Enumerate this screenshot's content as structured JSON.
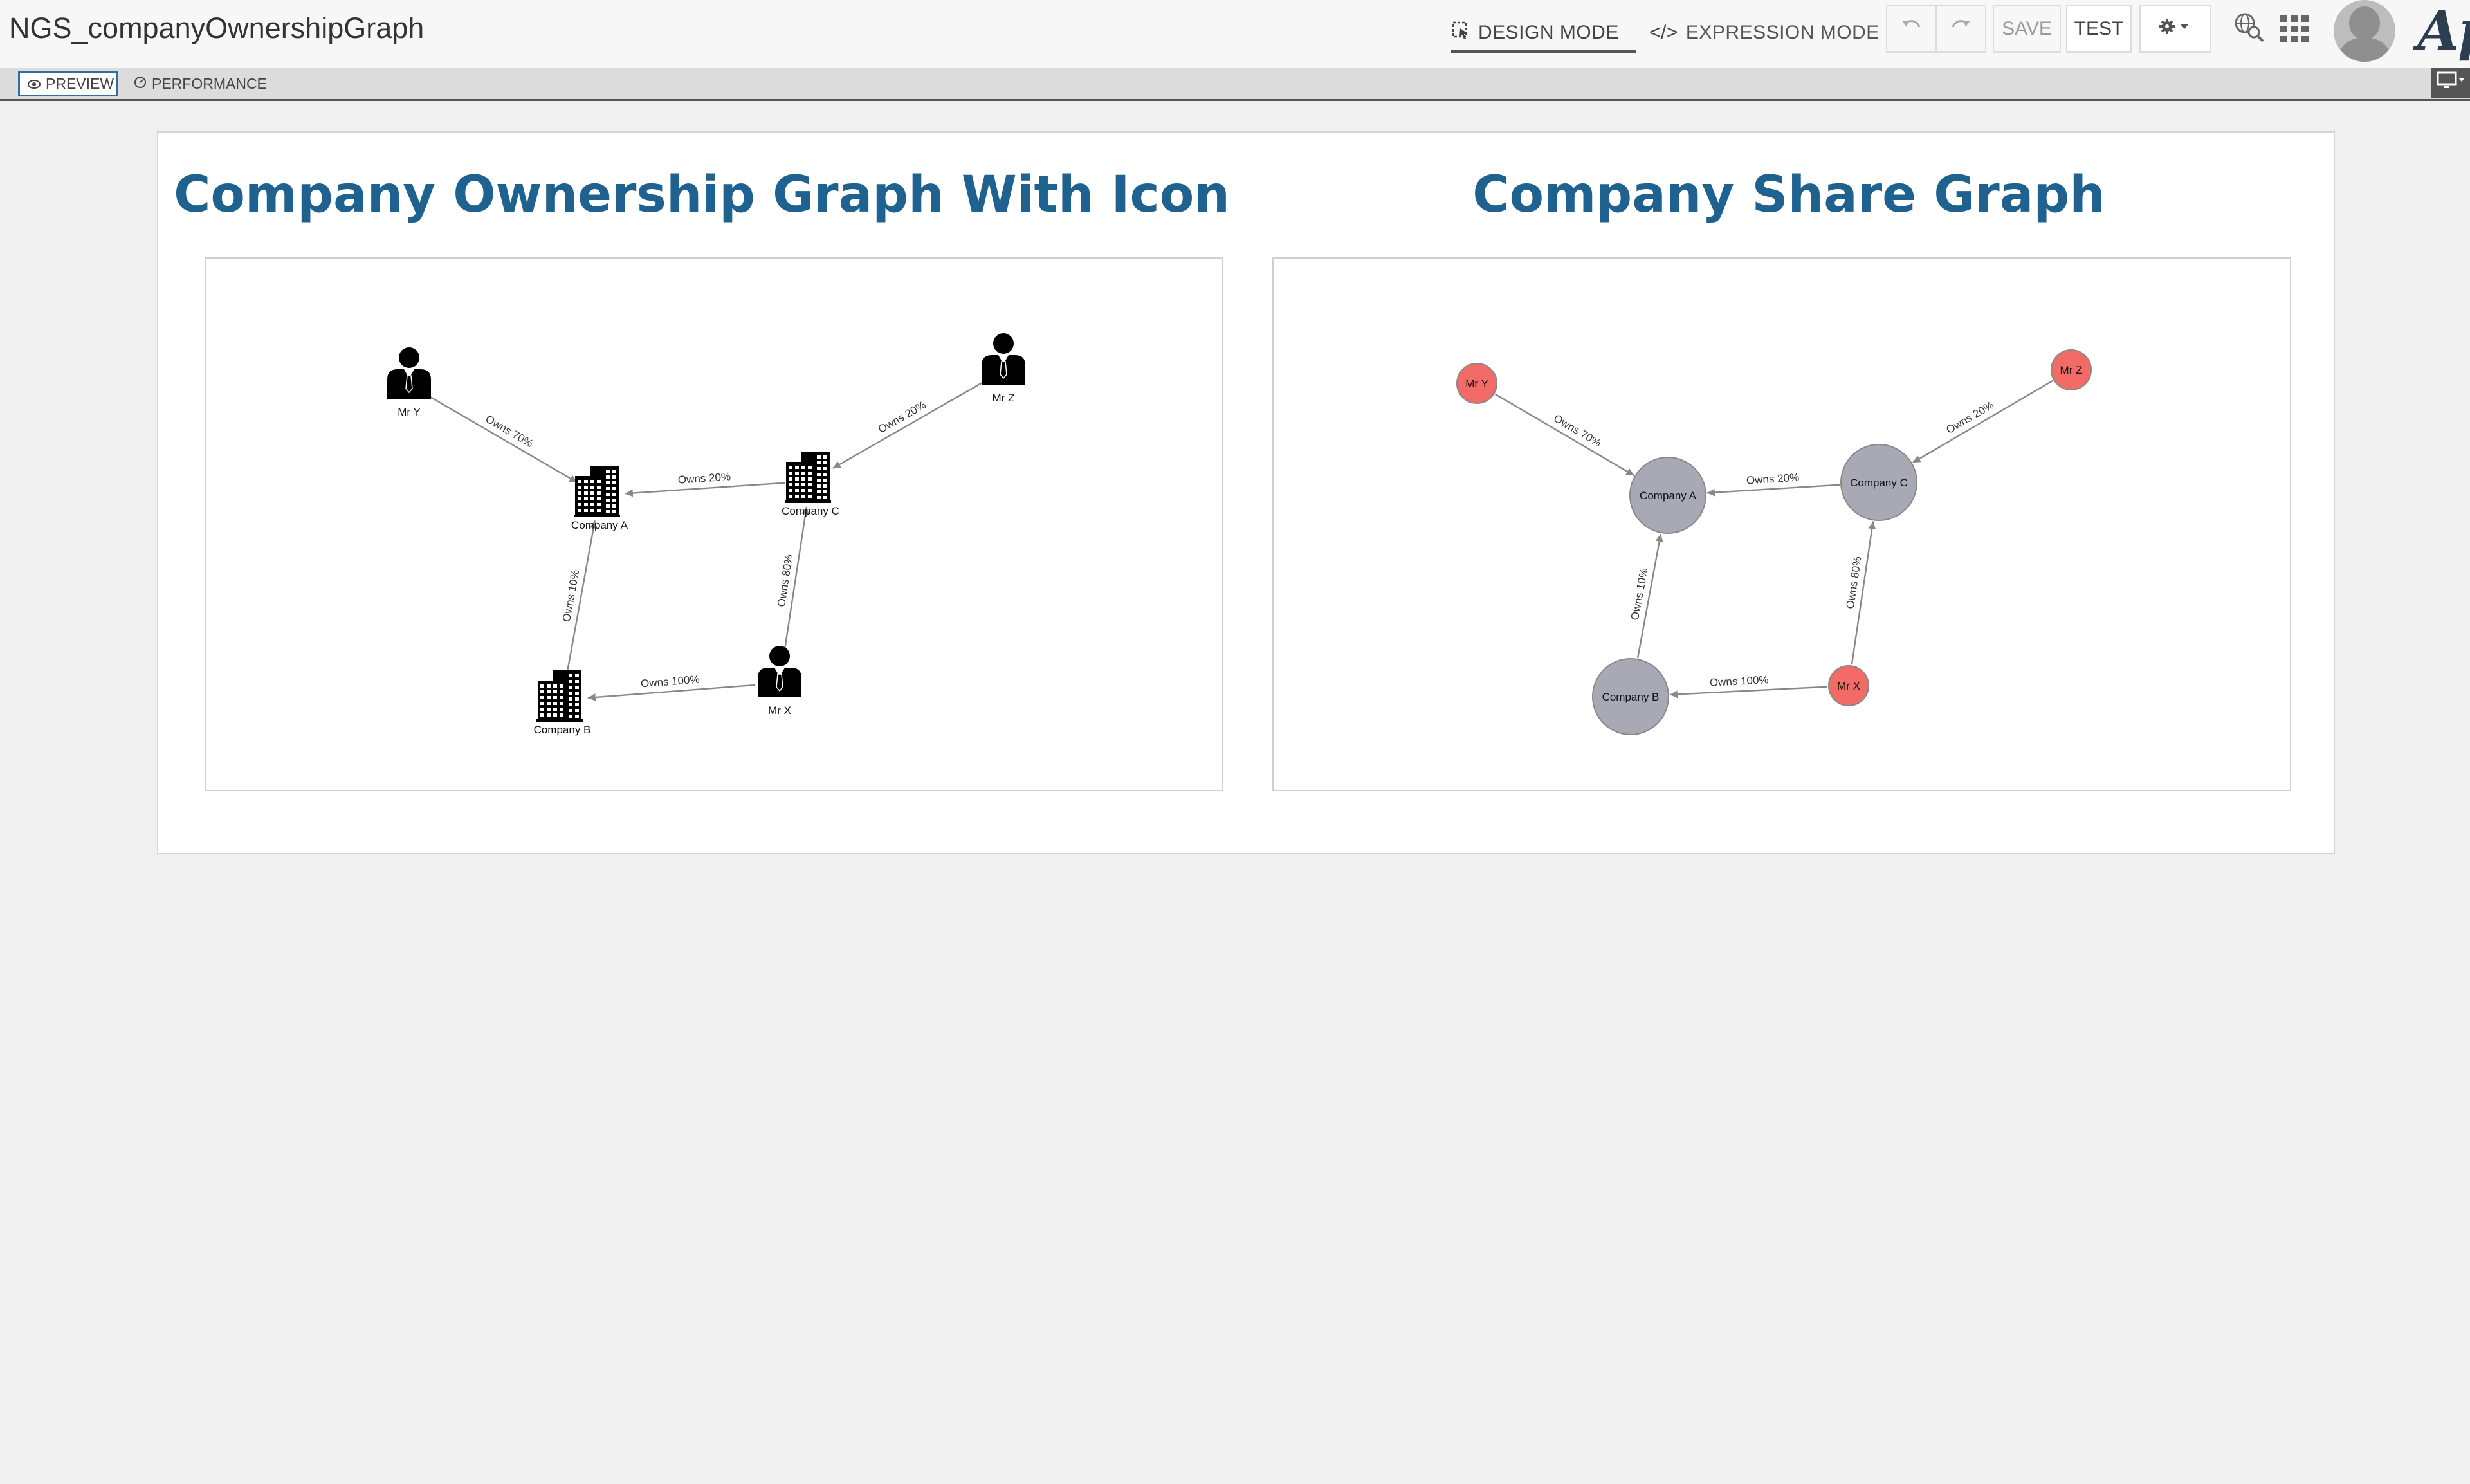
{
  "app": {
    "title": "NGS_companyOwnershipGraph",
    "brand": "App"
  },
  "toolbar": {
    "design_mode": "DESIGN MODE",
    "expression_mode": "EXPRESSION MODE",
    "save": "SAVE",
    "test": "TEST"
  },
  "tabs": {
    "preview": "PREVIEW",
    "performance": "PERFORMANCE"
  },
  "graph1": {
    "title": "Company Ownership Graph With Icon",
    "nodes": [
      {
        "id": "mry",
        "label": "Mr Y",
        "type": "person"
      },
      {
        "id": "mrz",
        "label": "Mr Z",
        "type": "person"
      },
      {
        "id": "ca",
        "label": "Company A",
        "type": "company"
      },
      {
        "id": "cc",
        "label": "Company C",
        "type": "company"
      },
      {
        "id": "cb",
        "label": "Company B",
        "type": "company"
      },
      {
        "id": "mrx",
        "label": "Mr X",
        "type": "person"
      }
    ],
    "edges": [
      {
        "from": "mry",
        "to": "ca",
        "label": "Owns 70%"
      },
      {
        "from": "mrz",
        "to": "cc",
        "label": "Owns 20%"
      },
      {
        "from": "cc",
        "to": "ca",
        "label": "Owns 20%"
      },
      {
        "from": "cb",
        "to": "ca",
        "label": "Owns 10%"
      },
      {
        "from": "mrx",
        "to": "cc",
        "label": "Owns 80%"
      },
      {
        "from": "mrx",
        "to": "cb",
        "label": "Owns 100%"
      }
    ]
  },
  "graph2": {
    "title": "Company Share Graph",
    "colors": {
      "person": "#f26b66",
      "company": "#a8a9b5"
    },
    "nodes": [
      {
        "id": "mry",
        "label": "Mr Y",
        "type": "person"
      },
      {
        "id": "mrz",
        "label": "Mr Z",
        "type": "person"
      },
      {
        "id": "ca",
        "label": "Company A",
        "type": "company"
      },
      {
        "id": "cc",
        "label": "Company C",
        "type": "company"
      },
      {
        "id": "cb",
        "label": "Company B",
        "type": "company"
      },
      {
        "id": "mrx",
        "label": "Mr X",
        "type": "person"
      }
    ],
    "edges": [
      {
        "from": "mry",
        "to": "ca",
        "label": "Owns 70%"
      },
      {
        "from": "mrz",
        "to": "cc",
        "label": "Owns 20%"
      },
      {
        "from": "cc",
        "to": "ca",
        "label": "Owns 20%"
      },
      {
        "from": "cb",
        "to": "ca",
        "label": "Owns 10%"
      },
      {
        "from": "mrx",
        "to": "cc",
        "label": "Owns 80%"
      },
      {
        "from": "mrx",
        "to": "cb",
        "label": "Owns 100%"
      }
    ]
  }
}
